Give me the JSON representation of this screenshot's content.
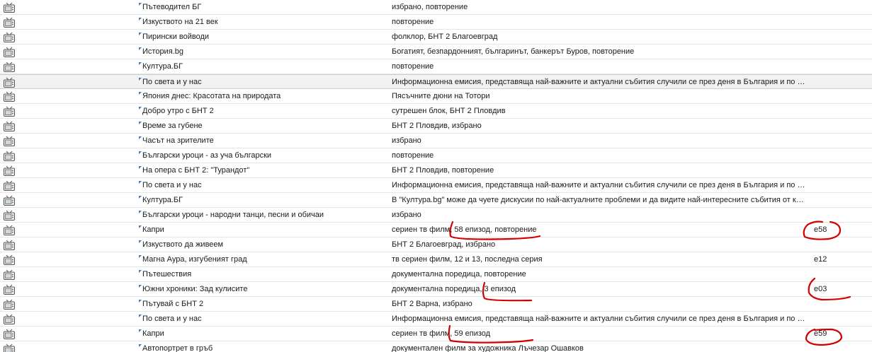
{
  "rows": [
    {
      "title": "Пътеводител БГ",
      "description": "избрано, повторение",
      "episode": ""
    },
    {
      "title": "Изкуството на 21 век",
      "description": "повторение",
      "episode": ""
    },
    {
      "title": "Пирински войводи",
      "description": "фолклор, БНТ 2 Благоевград",
      "episode": ""
    },
    {
      "title": "История.bg",
      "description": "Богатият, безпардонният, българинът, банкерът Буров, повторение",
      "episode": ""
    },
    {
      "title": "Култура.БГ",
      "description": "повторение",
      "episode": ""
    },
    {
      "title": "По света и у нас",
      "description": "Информационна емисия, представяща най-важните и актуални събития случили се през деня в България и по света",
      "episode": "",
      "selected": true
    },
    {
      "title": "Япония днес: Красотата на природата",
      "description": "Пясъчните дюни на Тотори",
      "episode": ""
    },
    {
      "title": "Добро утро с БНТ 2",
      "description": "сутрешен блок, БНТ 2 Пловдив",
      "episode": ""
    },
    {
      "title": "Време за губене",
      "description": "БНТ 2 Пловдив, избрано",
      "episode": ""
    },
    {
      "title": "Часът на зрителите",
      "description": "избрано",
      "episode": ""
    },
    {
      "title": "Български уроци - аз уча български",
      "description": "повторение",
      "episode": ""
    },
    {
      "title": "На опера с БНТ 2: \"Турандот\"",
      "description": "БНТ 2 Пловдив, повторение",
      "episode": ""
    },
    {
      "title": "По света и у нас",
      "description": "Информационна емисия, представяща най-важните и актуални събития случили се през деня в България и по света",
      "episode": ""
    },
    {
      "title": "Култура.БГ",
      "description": "В \"Култура.bg\" може да чуете дискусии по най-актуалните проблеми и да видите най-интересните събития от културния живот",
      "episode": ""
    },
    {
      "title": "Български уроци - народни танци, песни и обичаи",
      "description": "избрано",
      "episode": ""
    },
    {
      "title": "Капри",
      "description": "сериен тв филм, 58 епизод, повторение",
      "episode": "e58"
    },
    {
      "title": "Изкуството да живеем",
      "description": "БНТ 2 Благоевград, избрано",
      "episode": ""
    },
    {
      "title": "Магна Аура, изгубеният град",
      "description": "тв сериен филм, 12 и 13, последна серия",
      "episode": "e12"
    },
    {
      "title": "Пътешествия",
      "description": "документална поредица, повторение",
      "episode": ""
    },
    {
      "title": "Южни хроники: Зад кулисите",
      "description": "документална поредица, 3 епизод",
      "episode": "e03"
    },
    {
      "title": "Пътувай с БНТ 2",
      "description": "БНТ 2 Варна, избрано",
      "episode": ""
    },
    {
      "title": "По света и у нас",
      "description": "Информационна емисия, представяща най-важните и актуални събития случили се през деня в България и по света",
      "episode": ""
    },
    {
      "title": "Капри",
      "description": "сериен тв филм, 59 епизод",
      "episode": "e59"
    },
    {
      "title": "Автопортрет в гръб",
      "description": "документален филм за художника Лъчезар Ошавков",
      "episode": ""
    }
  ],
  "colors": {
    "annotation": "#d40000",
    "marker": "#3b78c4",
    "icon": "#555555"
  },
  "icons": {
    "row_icon": "tv-icon"
  }
}
